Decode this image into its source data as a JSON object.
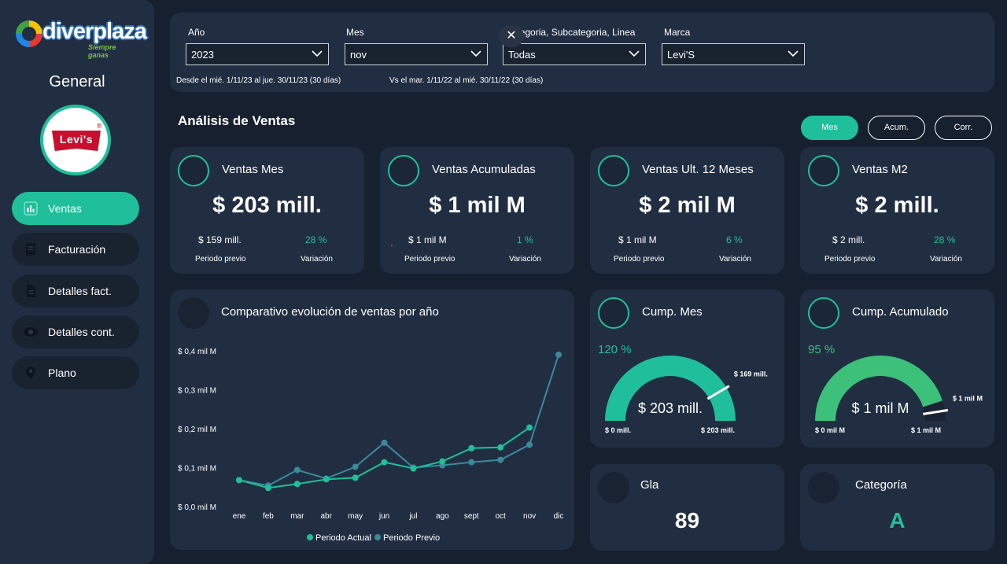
{
  "app": {
    "logo_text": "diverplaza",
    "logo_tagline": "Siempre ganas",
    "page_heading": "General",
    "brand_logo_text": "Levi's",
    "brand_logo_mark": "®"
  },
  "sidebar": {
    "items": [
      {
        "label": "Ventas",
        "icon": "bar-chart-icon",
        "active": true
      },
      {
        "label": "Facturación",
        "icon": "receipt-icon",
        "active": false
      },
      {
        "label": "Detalles fact.",
        "icon": "document-icon",
        "active": false
      },
      {
        "label": "Detalles cont.",
        "icon": "eye-icon",
        "active": false
      },
      {
        "label": "Plano",
        "icon": "map-pin-icon",
        "active": false
      }
    ]
  },
  "filters": {
    "anio": {
      "label": "Año",
      "value": "2023"
    },
    "mes": {
      "label": "Mes",
      "value": "nov"
    },
    "categoria": {
      "label": "Categoria, Subcategoria, Linea",
      "value": "Todas"
    },
    "marca": {
      "label": "Marca",
      "value": "Levi'S"
    },
    "clear_glyph": "✕",
    "range_current": "Desde el mié. 1/11/23 al jue. 30/11/23 (30 días)",
    "range_previous": "Vs el mar. 1/11/22 al mié. 30/11/22 (30 días)"
  },
  "section": {
    "title": "Análisis de Ventas"
  },
  "toggles": [
    {
      "label": "Mes",
      "active": true
    },
    {
      "label": "Acum.",
      "active": false
    },
    {
      "label": "Corr.",
      "active": false
    }
  ],
  "kpis": [
    {
      "title": "Ventas Mes",
      "value": "$ 203 mill.",
      "prev": "$ 159 mill.",
      "variation": "28 %",
      "prev_label": "Periodo previo",
      "var_label": "Variación"
    },
    {
      "title": "Ventas Acumuladas",
      "value": "$ 1 mil M",
      "prev": "$ 1 mil M",
      "variation": "1 %",
      "prev_label": "Periodo previo",
      "var_label": "Variación"
    },
    {
      "title": "Ventas Ult. 12 Meses",
      "value": "$ 2 mil M",
      "prev": "$ 1 mil M",
      "variation": "6 %",
      "prev_label": "Periodo previo",
      "var_label": "Variación"
    },
    {
      "title": "Ventas M2",
      "value": "$ 2 mill.",
      "prev": "$ 2 mill.",
      "variation": "28 %",
      "prev_label": "Periodo previo",
      "var_label": "Variación"
    }
  ],
  "gauges": [
    {
      "title": "Cump. Mes",
      "percent_label": "120 %",
      "value_label": "$ 203 mill.",
      "min_label": "$ 0 mill.",
      "max_label": "$ 203 mill.",
      "target_label": "$ 169 mill.",
      "fill": 1.0,
      "target": 0.83,
      "color": "#1fbf9b"
    },
    {
      "title": "Cump. Acumulado",
      "percent_label": "95 %",
      "value_label": "$ 1 mil M",
      "min_label": "$ 0 mil M",
      "max_label": "$ 1 mil M",
      "target_label": "$ 1 mil M",
      "fill": 0.9,
      "target": 0.95,
      "color": "#3cc07a"
    }
  ],
  "gla": {
    "title": "Gla",
    "value": "89"
  },
  "categoria": {
    "title": "Categoría",
    "value": "A"
  },
  "colors": {
    "accent": "#1fbf9b",
    "secondary": "#3a8a98",
    "panel": "#212e42",
    "background": "#16202e"
  },
  "chart_data": {
    "type": "line",
    "title": "Comparativo evolución de ventas por año",
    "categories": [
      "ene",
      "feb",
      "mar",
      "abr",
      "may",
      "jun",
      "jul",
      "ago",
      "sept",
      "oct",
      "nov",
      "dic"
    ],
    "y_tick_labels": [
      "$ 0,4 mil M",
      "$ 0,3 mil M",
      "$ 0,2 mil M",
      "$ 0,1 mil M",
      "$ 0,0 mil M"
    ],
    "y_ticks": [
      0.4,
      0.3,
      0.2,
      0.1,
      0.0
    ],
    "ylim": [
      0,
      0.4
    ],
    "grid": false,
    "legend": "bottom",
    "series": [
      {
        "name": "Periodo Actual",
        "color": "#1fbf9b",
        "values": [
          0.068,
          0.048,
          0.058,
          0.07,
          0.074,
          0.114,
          0.098,
          0.116,
          0.15,
          0.152,
          0.203,
          null
        ]
      },
      {
        "name": "Periodo Previo",
        "color": "#3a8a98",
        "values": [
          0.068,
          0.054,
          0.094,
          0.072,
          0.102,
          0.164,
          0.1,
          0.106,
          0.114,
          0.12,
          0.159,
          0.39
        ]
      }
    ]
  }
}
